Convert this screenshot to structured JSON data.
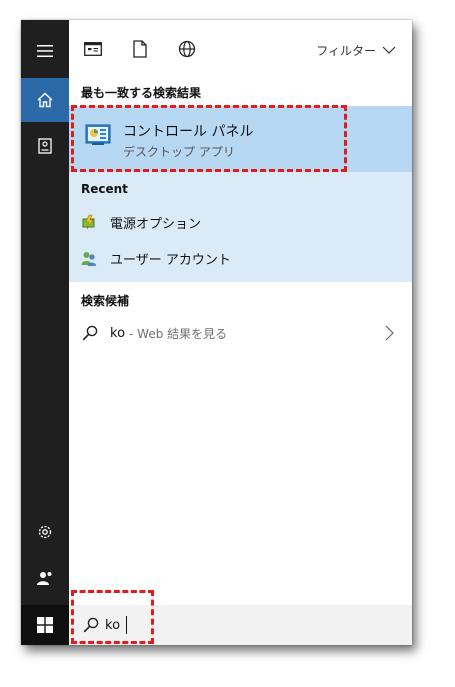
{
  "rail": {
    "items": [
      {
        "icon": "hamburger-menu-icon"
      },
      {
        "icon": "home-icon",
        "active": true
      },
      {
        "icon": "documents-icon"
      },
      {
        "icon": "gear-icon"
      },
      {
        "icon": "people-icon"
      },
      {
        "icon": "windows-start-icon"
      }
    ]
  },
  "toolbar": {
    "icons": [
      "apps-icon",
      "document-icon",
      "globe-icon"
    ],
    "filter_label": "フィルター"
  },
  "best_match": {
    "section_title": "最も一致する検索結果",
    "name": "コントロール パネル",
    "type": "デスクトップ アプリ",
    "icon": "control-panel-icon"
  },
  "recent": {
    "section_title": "Recent",
    "items": [
      {
        "label": "電源オプション",
        "icon": "power-options-icon"
      },
      {
        "label": "ユーザー アカウント",
        "icon": "user-accounts-icon"
      }
    ]
  },
  "suggestions": {
    "section_title": "検索候補",
    "items": [
      {
        "query": "ko",
        "suffix": "- Web 結果を見る"
      }
    ]
  },
  "search": {
    "value": "ko",
    "icon": "search-icon"
  },
  "colors": {
    "rail_bg": "#1f1f1f",
    "active_accent": "#2b6aa6",
    "best_match_bg": "#b7d8f2",
    "recent_bg": "#daeaf7",
    "highlight": "#e31b1b"
  }
}
